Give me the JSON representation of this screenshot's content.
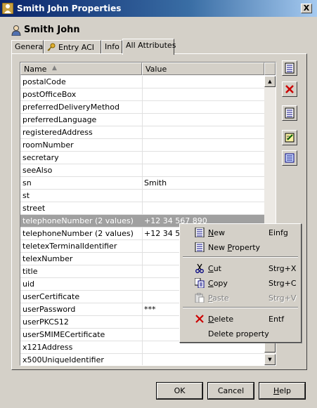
{
  "window": {
    "title": "Smith John Properties",
    "close_label": "X"
  },
  "header": {
    "user_name": "Smith John"
  },
  "tabs": [
    {
      "label": "General"
    },
    {
      "label": "Entry ACI"
    },
    {
      "label": "Info"
    },
    {
      "label": "All Attributes"
    }
  ],
  "table": {
    "columns": {
      "name": "Name",
      "value": "Value"
    },
    "rows": [
      {
        "name": "postalCode",
        "value": ""
      },
      {
        "name": "postOfficeBox",
        "value": ""
      },
      {
        "name": "preferredDeliveryMethod",
        "value": ""
      },
      {
        "name": "preferredLanguage",
        "value": ""
      },
      {
        "name": "registeredAddress",
        "value": ""
      },
      {
        "name": "roomNumber",
        "value": ""
      },
      {
        "name": "secretary",
        "value": ""
      },
      {
        "name": "seeAlso",
        "value": ""
      },
      {
        "name": "sn",
        "value": "Smith"
      },
      {
        "name": "st",
        "value": ""
      },
      {
        "name": "street",
        "value": ""
      },
      {
        "name": "telephoneNumber  (2 values)",
        "value": "+12 34 567 890",
        "selected": true
      },
      {
        "name": "telephoneNumber  (2 values)",
        "value": "+12 34 56"
      },
      {
        "name": "teletexTerminalIdentifier",
        "value": ""
      },
      {
        "name": "telexNumber",
        "value": ""
      },
      {
        "name": "title",
        "value": ""
      },
      {
        "name": "uid",
        "value": ""
      },
      {
        "name": "userCertificate",
        "value": ""
      },
      {
        "name": "userPassword",
        "value": "***"
      },
      {
        "name": "userPKCS12",
        "value": ""
      },
      {
        "name": "userSMIMECertificate",
        "value": ""
      },
      {
        "name": "x121Address",
        "value": ""
      },
      {
        "name": "x500UniqueIdentifier",
        "value": ""
      }
    ]
  },
  "side_buttons": [
    {
      "icon": "new-value-icon"
    },
    {
      "icon": "delete-icon"
    },
    {
      "icon": "new-attribute-icon"
    },
    {
      "icon": "edit-icon"
    },
    {
      "icon": "properties-icon"
    }
  ],
  "context_menu": {
    "items": [
      {
        "label": "New",
        "shortcut": "Einfg",
        "icon": "new-icon",
        "enabled": true
      },
      {
        "label": "New Property",
        "shortcut": "",
        "icon": "new-property-icon",
        "enabled": true
      },
      {
        "label": "Cut",
        "shortcut": "Strg+X",
        "icon": "scissors-icon",
        "enabled": true
      },
      {
        "label": "Copy",
        "shortcut": "Strg+C",
        "icon": "copy-icon",
        "enabled": true
      },
      {
        "label": "Paste",
        "shortcut": "Strg+V",
        "icon": "paste-icon",
        "enabled": false
      },
      {
        "label": "Delete",
        "shortcut": "Entf",
        "icon": "delete-icon",
        "enabled": true
      },
      {
        "label": "Delete property",
        "shortcut": "",
        "icon": "",
        "enabled": true
      }
    ]
  },
  "buttons": {
    "ok": "OK",
    "cancel": "Cancel",
    "help": "Help"
  },
  "colors": {
    "title_bar": "#0a246a",
    "selection": "#a0a0a0",
    "delete_red": "#cc0000"
  }
}
